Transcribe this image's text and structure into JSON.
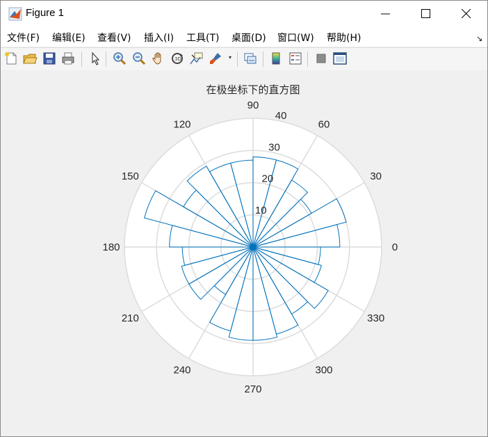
{
  "window": {
    "title": "Figure 1"
  },
  "menu": [
    {
      "label": "文件(F)"
    },
    {
      "label": "编辑(E)"
    },
    {
      "label": "查看(V)"
    },
    {
      "label": "插入(I)"
    },
    {
      "label": "工具(T)"
    },
    {
      "label": "桌面(D)"
    },
    {
      "label": "窗口(W)"
    },
    {
      "label": "帮助(H)"
    }
  ],
  "toolbar": {
    "icons": [
      "new-file-icon",
      "open-folder-icon",
      "save-icon",
      "print-icon",
      "pointer-icon",
      "zoom-in-icon",
      "zoom-out-icon",
      "pan-hand-icon",
      "rotate-3d-icon",
      "data-cursor-icon",
      "brush-icon",
      "link-plot-icon",
      "colorbar-icon",
      "legend-icon",
      "hide-plot-tools-icon",
      "show-plot-tools-icon"
    ]
  },
  "colors": {
    "accent": "#0072bd",
    "grid": "#dcdcdc",
    "plot_bg": "#ffffff",
    "figure_bg": "#f0f0f0"
  },
  "chart_data": {
    "type": "polar-histogram",
    "title": "在极坐标下的直方图",
    "bin_count": 24,
    "bin_width_deg": 15,
    "bin_starts_deg": [
      0,
      15,
      30,
      45,
      60,
      75,
      90,
      105,
      120,
      135,
      150,
      165,
      180,
      195,
      210,
      225,
      240,
      255,
      270,
      285,
      300,
      315,
      330,
      345
    ],
    "values": [
      27,
      30,
      21,
      24,
      28,
      28,
      27,
      27,
      29,
      25,
      35,
      26,
      22,
      23,
      23,
      17,
      27,
      29,
      29,
      28,
      24,
      27,
      22,
      21
    ],
    "r_ticks": [
      10,
      20,
      30,
      40
    ],
    "rlim": [
      0,
      40
    ],
    "theta_ticks": [
      "0",
      "30",
      "60",
      "90",
      "120",
      "150",
      "180",
      "210",
      "240",
      "270",
      "300",
      "330"
    ],
    "grid": true
  }
}
